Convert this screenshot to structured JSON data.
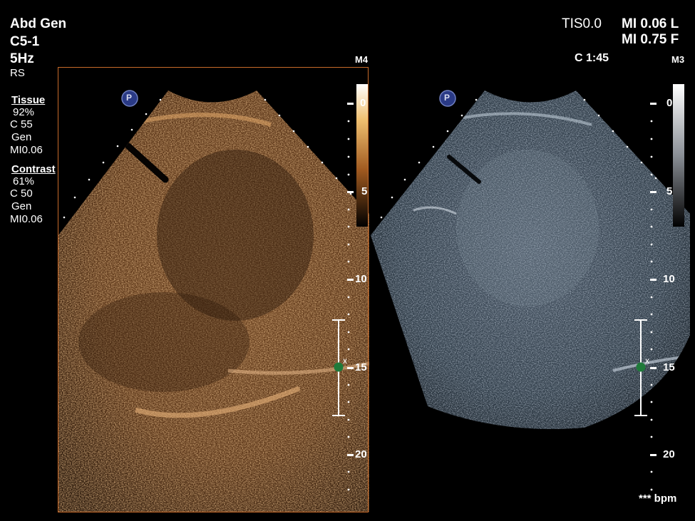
{
  "preset": {
    "exam": "Abd Gen",
    "probe": "C5-1",
    "frequency": "5Hz",
    "orientation": "RS"
  },
  "tissue": {
    "title": "Tissue",
    "gain": "92%",
    "compression": "C 55",
    "mode": "Gen",
    "mi": "MI0.06"
  },
  "contrast": {
    "title": "Contrast",
    "gain": "61%",
    "compression": "C 50",
    "mode": "Gen",
    "mi": "MI0.06"
  },
  "safety": {
    "tis": "TIS0.0",
    "mi_left": "MI 0.06 L",
    "mi_right": "MI 0.75 F"
  },
  "timer": "C 1:45",
  "left_panel": {
    "map_label": "M4",
    "depth_ticks": [
      "0",
      "5",
      "10",
      "15",
      "20"
    ],
    "marker": "P",
    "focus_marker": "x"
  },
  "right_panel": {
    "map_label": "M3",
    "depth_ticks": [
      "0",
      "5",
      "10",
      "15",
      "20"
    ],
    "marker": "P",
    "focus_marker": "x"
  },
  "heart_rate": "*** bpm",
  "colors": {
    "contrast_tint": "#b9773a",
    "tissue_tint": "#7f93a6",
    "frame": "#c76a2a",
    "focus_dot": "#1f7a3a"
  }
}
